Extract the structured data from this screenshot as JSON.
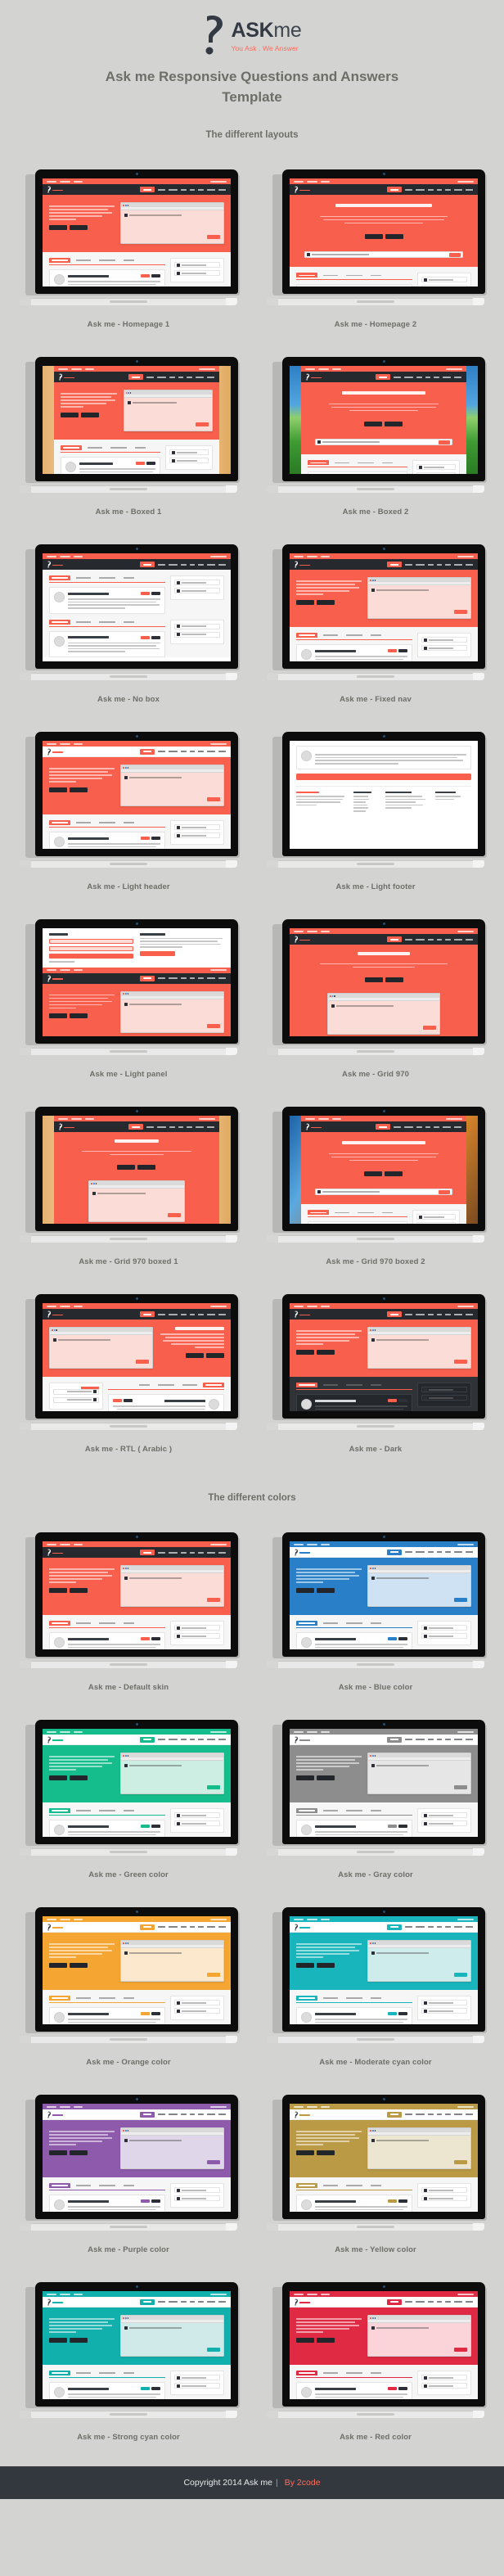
{
  "brand": {
    "logo_title_bold": "ASK",
    "logo_title_thin": "me",
    "tagline": "You Ask . We Answer",
    "accent": "#ff6b5b",
    "dark": "#343a44"
  },
  "header": {
    "main_title": "Ask me Responsive Questions and Answers Template"
  },
  "sections": [
    {
      "id": "layouts",
      "title": "The different layouts"
    },
    {
      "id": "colors",
      "title": "The different colors"
    }
  ],
  "layouts": [
    {
      "label": "Ask me - Homepage 1",
      "variant": "home1",
      "accent": "#f8604d",
      "nav": "dark",
      "bg": "none"
    },
    {
      "label": "Ask me - Homepage 2",
      "variant": "home2",
      "accent": "#f8604d",
      "nav": "dark",
      "bg": "none"
    },
    {
      "label": "Ask me - Boxed 1",
      "variant": "home1",
      "accent": "#f8604d",
      "nav": "dark",
      "bg": "wood"
    },
    {
      "label": "Ask me - Boxed 2",
      "variant": "home2",
      "accent": "#f8604d",
      "nav": "dark",
      "bg": "photo"
    },
    {
      "label": "Ask me - No box",
      "variant": "nobox",
      "accent": "#f8604d",
      "nav": "dark",
      "bg": "none"
    },
    {
      "label": "Ask me - Fixed nav",
      "variant": "home1",
      "accent": "#f8604d",
      "nav": "dark",
      "bg": "none"
    },
    {
      "label": "Ask me - Light header",
      "variant": "home1",
      "accent": "#f8604d",
      "nav": "light",
      "bg": "none"
    },
    {
      "label": "Ask me - Light footer",
      "variant": "footer",
      "accent": "#f8604d",
      "nav": "none",
      "bg": "none"
    },
    {
      "label": "Ask me - Light panel",
      "variant": "panel",
      "accent": "#f8604d",
      "nav": "dark",
      "bg": "none"
    },
    {
      "label": "Ask me - Grid 970",
      "variant": "grid970",
      "accent": "#f8604d",
      "nav": "dark",
      "bg": "none"
    },
    {
      "label": "Ask me - Grid 970 boxed 1",
      "variant": "grid970",
      "accent": "#f8604d",
      "nav": "dark",
      "bg": "wood"
    },
    {
      "label": "Ask me - Grid 970 boxed 2",
      "variant": "home2",
      "accent": "#f8604d",
      "nav": "dark",
      "bg": "photo2"
    },
    {
      "label": "Ask me - RTL ( Arabic )",
      "variant": "rtl",
      "accent": "#f8604d",
      "nav": "dark",
      "bg": "none"
    },
    {
      "label": "Ask me - Dark",
      "variant": "dark",
      "accent": "#f8604d",
      "nav": "dark",
      "bg": "none"
    }
  ],
  "colors": [
    {
      "label": "Ask me - Default skin",
      "accent": "#f8604d",
      "tint": "#fcdcd6",
      "nav": "dark"
    },
    {
      "label": "Ask me - Blue color",
      "accent": "#2980c9",
      "tint": "#cfe2f3",
      "nav": "light"
    },
    {
      "label": "Ask me - Green color",
      "accent": "#16bd8c",
      "tint": "#cdeee2",
      "nav": "light"
    },
    {
      "label": "Ask me - Gray color",
      "accent": "#8d8d8d",
      "tint": "#e6e6e6",
      "nav": "light"
    },
    {
      "label": "Ask me - Orange color",
      "accent": "#f5a632",
      "tint": "#fbe8cd",
      "nav": "light"
    },
    {
      "label": "Ask me - Moderate cyan color",
      "accent": "#19b5bd",
      "tint": "#cfeced",
      "nav": "light"
    },
    {
      "label": "Ask me - Purple color",
      "accent": "#8e5aab",
      "tint": "#e0d6ea",
      "nav": "light"
    },
    {
      "label": "Ask me - Yellow color",
      "accent": "#bb9a46",
      "tint": "#ece5cf",
      "nav": "light"
    },
    {
      "label": "Ask me - Strong cyan color",
      "accent": "#12b0ac",
      "tint": "#cfeae9",
      "nav": "light"
    },
    {
      "label": "Ask me - Red color",
      "accent": "#e02a44",
      "tint": "#fbd4da",
      "nav": "light"
    }
  ],
  "footer": {
    "copyright": "Copyright 2014 Ask me",
    "separator": "|",
    "by": "By 2code"
  }
}
